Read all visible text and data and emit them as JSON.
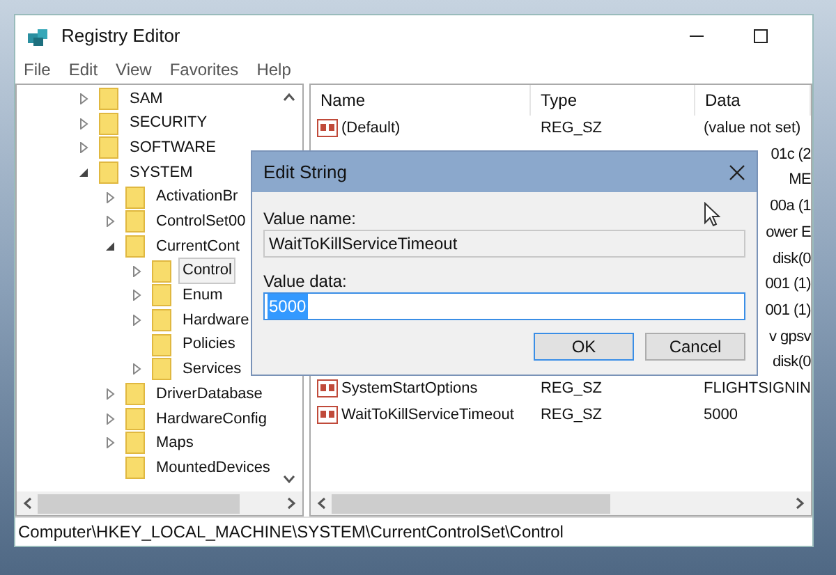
{
  "window": {
    "title": "Registry Editor"
  },
  "menu": [
    "File",
    "Edit",
    "View",
    "Favorites",
    "Help"
  ],
  "tree": [
    {
      "label": "SAM",
      "expanded": false,
      "selected": false
    },
    {
      "label": "SECURITY",
      "expanded": false,
      "selected": false
    },
    {
      "label": "SOFTWARE",
      "expanded": false,
      "selected": false
    },
    {
      "label": "SYSTEM",
      "expanded": true,
      "selected": false,
      "children": [
        {
          "label": "ActivationBr",
          "expanded": false,
          "selected": false
        },
        {
          "label": "ControlSet00",
          "expanded": false,
          "selected": false
        },
        {
          "label": "CurrentCont",
          "expanded": true,
          "selected": false,
          "children": [
            {
              "label": "Control",
              "expanded": false,
              "selected": true
            },
            {
              "label": "Enum",
              "expanded": false,
              "selected": false
            },
            {
              "label": "Hardware",
              "expanded": false,
              "selected": false
            },
            {
              "label": "Policies",
              "selected": false
            },
            {
              "label": "Services",
              "expanded": false,
              "selected": false
            }
          ]
        },
        {
          "label": "DriverDatabase",
          "expanded": false,
          "selected": false
        },
        {
          "label": "HardwareConfig",
          "expanded": false,
          "selected": false
        },
        {
          "label": "Maps",
          "expanded": false,
          "selected": false
        },
        {
          "label": "MountedDevices",
          "selected": false
        }
      ]
    }
  ],
  "table": {
    "columns": [
      "Name",
      "Type",
      "Data"
    ],
    "rows": [
      {
        "name": "(Default)",
        "type": "REG_SZ",
        "data": "(value not set)"
      },
      {
        "data": "01c (2"
      },
      {
        "data": "ME"
      },
      {
        "data": "00a (1"
      },
      {
        "data": "ower E"
      },
      {
        "data": "disk(0"
      },
      {
        "data": "001 (1)"
      },
      {
        "data": "001 (1)"
      },
      {
        "data": "v gpsv"
      },
      {
        "data": "disk(0"
      },
      {
        "name": "SystemStartOptions",
        "type": "REG_SZ",
        "data": "FLIGHTSIGNIN"
      },
      {
        "name": "WaitToKillServiceTimeout",
        "type": "REG_SZ",
        "data": "5000"
      }
    ]
  },
  "status_bar": "Computer\\HKEY_LOCAL_MACHINE\\SYSTEM\\CurrentControlSet\\Control",
  "dialog": {
    "title": "Edit String",
    "name_label": "Value name:",
    "name_value": "WaitToKillServiceTimeout",
    "data_label": "Value data:",
    "data_value": "5000",
    "buttons": [
      "OK",
      "Cancel"
    ]
  }
}
